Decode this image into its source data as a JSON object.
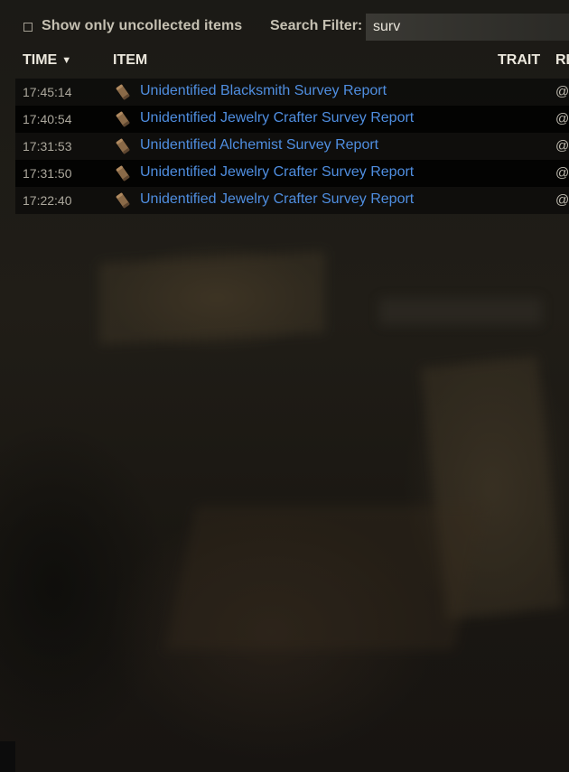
{
  "filters": {
    "uncollected_label": "Show only uncollected items",
    "uncollected_checked": false,
    "search_label": "Search Filter:",
    "search_value": "surv"
  },
  "columns": {
    "time": "TIME",
    "sort_indicator": "▼",
    "item": "ITEM",
    "trait": "TRAIT",
    "re": "RE"
  },
  "rows": [
    {
      "time": "17:45:14",
      "item": "Unidentified Blacksmith Survey Report",
      "account": "@"
    },
    {
      "time": "17:40:54",
      "item": "Unidentified Jewelry Crafter Survey Report",
      "account": "@"
    },
    {
      "time": "17:31:53",
      "item": "Unidentified Alchemist Survey Report",
      "account": "@"
    },
    {
      "time": "17:31:50",
      "item": "Unidentified Jewelry Crafter Survey Report",
      "account": "@"
    },
    {
      "time": "17:22:40",
      "item": "Unidentified Jewelry Crafter Survey Report",
      "account": "@"
    }
  ],
  "icons": {
    "row_icon": "survey-scroll-icon"
  },
  "colors": {
    "item_link": "#4f8ee0",
    "header_text": "#ece8dd",
    "label_text": "#c5c0b2"
  }
}
